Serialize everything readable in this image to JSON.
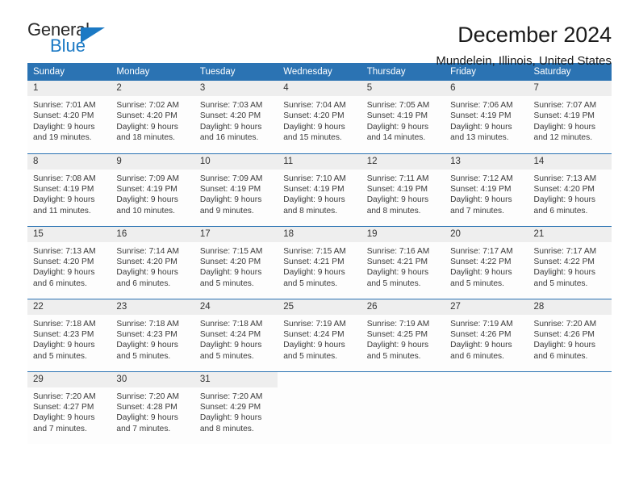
{
  "logo": {
    "name_part1": "General",
    "name_part2": "Blue",
    "flag_icon": "blue-triangle-flag-icon",
    "brand_color": "#1b79c4"
  },
  "header": {
    "title": "December 2024",
    "subtitle": "Mundelein, Illinois, United States"
  },
  "theme": {
    "header_blue": "#2b73b3",
    "daynum_gray": "#eeeeee",
    "text_dark": "#3a3a3a"
  },
  "labels": {
    "sunrise_prefix": "Sunrise:",
    "sunset_prefix": "Sunset:",
    "daylight_prefix": "Daylight:"
  },
  "weekday_headers": [
    "Sunday",
    "Monday",
    "Tuesday",
    "Wednesday",
    "Thursday",
    "Friday",
    "Saturday"
  ],
  "weeks": [
    [
      {
        "day": "1",
        "sunrise": "Sunrise: 7:01 AM",
        "sunset": "Sunset: 4:20 PM",
        "daylight_line1": "Daylight: 9 hours",
        "daylight_line2": "and 19 minutes."
      },
      {
        "day": "2",
        "sunrise": "Sunrise: 7:02 AM",
        "sunset": "Sunset: 4:20 PM",
        "daylight_line1": "Daylight: 9 hours",
        "daylight_line2": "and 18 minutes."
      },
      {
        "day": "3",
        "sunrise": "Sunrise: 7:03 AM",
        "sunset": "Sunset: 4:20 PM",
        "daylight_line1": "Daylight: 9 hours",
        "daylight_line2": "and 16 minutes."
      },
      {
        "day": "4",
        "sunrise": "Sunrise: 7:04 AM",
        "sunset": "Sunset: 4:20 PM",
        "daylight_line1": "Daylight: 9 hours",
        "daylight_line2": "and 15 minutes."
      },
      {
        "day": "5",
        "sunrise": "Sunrise: 7:05 AM",
        "sunset": "Sunset: 4:19 PM",
        "daylight_line1": "Daylight: 9 hours",
        "daylight_line2": "and 14 minutes."
      },
      {
        "day": "6",
        "sunrise": "Sunrise: 7:06 AM",
        "sunset": "Sunset: 4:19 PM",
        "daylight_line1": "Daylight: 9 hours",
        "daylight_line2": "and 13 minutes."
      },
      {
        "day": "7",
        "sunrise": "Sunrise: 7:07 AM",
        "sunset": "Sunset: 4:19 PM",
        "daylight_line1": "Daylight: 9 hours",
        "daylight_line2": "and 12 minutes."
      }
    ],
    [
      {
        "day": "8",
        "sunrise": "Sunrise: 7:08 AM",
        "sunset": "Sunset: 4:19 PM",
        "daylight_line1": "Daylight: 9 hours",
        "daylight_line2": "and 11 minutes."
      },
      {
        "day": "9",
        "sunrise": "Sunrise: 7:09 AM",
        "sunset": "Sunset: 4:19 PM",
        "daylight_line1": "Daylight: 9 hours",
        "daylight_line2": "and 10 minutes."
      },
      {
        "day": "10",
        "sunrise": "Sunrise: 7:09 AM",
        "sunset": "Sunset: 4:19 PM",
        "daylight_line1": "Daylight: 9 hours",
        "daylight_line2": "and 9 minutes."
      },
      {
        "day": "11",
        "sunrise": "Sunrise: 7:10 AM",
        "sunset": "Sunset: 4:19 PM",
        "daylight_line1": "Daylight: 9 hours",
        "daylight_line2": "and 8 minutes."
      },
      {
        "day": "12",
        "sunrise": "Sunrise: 7:11 AM",
        "sunset": "Sunset: 4:19 PM",
        "daylight_line1": "Daylight: 9 hours",
        "daylight_line2": "and 8 minutes."
      },
      {
        "day": "13",
        "sunrise": "Sunrise: 7:12 AM",
        "sunset": "Sunset: 4:19 PM",
        "daylight_line1": "Daylight: 9 hours",
        "daylight_line2": "and 7 minutes."
      },
      {
        "day": "14",
        "sunrise": "Sunrise: 7:13 AM",
        "sunset": "Sunset: 4:20 PM",
        "daylight_line1": "Daylight: 9 hours",
        "daylight_line2": "and 6 minutes."
      }
    ],
    [
      {
        "day": "15",
        "sunrise": "Sunrise: 7:13 AM",
        "sunset": "Sunset: 4:20 PM",
        "daylight_line1": "Daylight: 9 hours",
        "daylight_line2": "and 6 minutes."
      },
      {
        "day": "16",
        "sunrise": "Sunrise: 7:14 AM",
        "sunset": "Sunset: 4:20 PM",
        "daylight_line1": "Daylight: 9 hours",
        "daylight_line2": "and 6 minutes."
      },
      {
        "day": "17",
        "sunrise": "Sunrise: 7:15 AM",
        "sunset": "Sunset: 4:20 PM",
        "daylight_line1": "Daylight: 9 hours",
        "daylight_line2": "and 5 minutes."
      },
      {
        "day": "18",
        "sunrise": "Sunrise: 7:15 AM",
        "sunset": "Sunset: 4:21 PM",
        "daylight_line1": "Daylight: 9 hours",
        "daylight_line2": "and 5 minutes."
      },
      {
        "day": "19",
        "sunrise": "Sunrise: 7:16 AM",
        "sunset": "Sunset: 4:21 PM",
        "daylight_line1": "Daylight: 9 hours",
        "daylight_line2": "and 5 minutes."
      },
      {
        "day": "20",
        "sunrise": "Sunrise: 7:17 AM",
        "sunset": "Sunset: 4:22 PM",
        "daylight_line1": "Daylight: 9 hours",
        "daylight_line2": "and 5 minutes."
      },
      {
        "day": "21",
        "sunrise": "Sunrise: 7:17 AM",
        "sunset": "Sunset: 4:22 PM",
        "daylight_line1": "Daylight: 9 hours",
        "daylight_line2": "and 5 minutes."
      }
    ],
    [
      {
        "day": "22",
        "sunrise": "Sunrise: 7:18 AM",
        "sunset": "Sunset: 4:23 PM",
        "daylight_line1": "Daylight: 9 hours",
        "daylight_line2": "and 5 minutes."
      },
      {
        "day": "23",
        "sunrise": "Sunrise: 7:18 AM",
        "sunset": "Sunset: 4:23 PM",
        "daylight_line1": "Daylight: 9 hours",
        "daylight_line2": "and 5 minutes."
      },
      {
        "day": "24",
        "sunrise": "Sunrise: 7:18 AM",
        "sunset": "Sunset: 4:24 PM",
        "daylight_line1": "Daylight: 9 hours",
        "daylight_line2": "and 5 minutes."
      },
      {
        "day": "25",
        "sunrise": "Sunrise: 7:19 AM",
        "sunset": "Sunset: 4:24 PM",
        "daylight_line1": "Daylight: 9 hours",
        "daylight_line2": "and 5 minutes."
      },
      {
        "day": "26",
        "sunrise": "Sunrise: 7:19 AM",
        "sunset": "Sunset: 4:25 PM",
        "daylight_line1": "Daylight: 9 hours",
        "daylight_line2": "and 5 minutes."
      },
      {
        "day": "27",
        "sunrise": "Sunrise: 7:19 AM",
        "sunset": "Sunset: 4:26 PM",
        "daylight_line1": "Daylight: 9 hours",
        "daylight_line2": "and 6 minutes."
      },
      {
        "day": "28",
        "sunrise": "Sunrise: 7:20 AM",
        "sunset": "Sunset: 4:26 PM",
        "daylight_line1": "Daylight: 9 hours",
        "daylight_line2": "and 6 minutes."
      }
    ],
    [
      {
        "day": "29",
        "sunrise": "Sunrise: 7:20 AM",
        "sunset": "Sunset: 4:27 PM",
        "daylight_line1": "Daylight: 9 hours",
        "daylight_line2": "and 7 minutes."
      },
      {
        "day": "30",
        "sunrise": "Sunrise: 7:20 AM",
        "sunset": "Sunset: 4:28 PM",
        "daylight_line1": "Daylight: 9 hours",
        "daylight_line2": "and 7 minutes."
      },
      {
        "day": "31",
        "sunrise": "Sunrise: 7:20 AM",
        "sunset": "Sunset: 4:29 PM",
        "daylight_line1": "Daylight: 9 hours",
        "daylight_line2": "and 8 minutes."
      },
      {
        "day": "",
        "sunrise": "",
        "sunset": "",
        "daylight_line1": "",
        "daylight_line2": ""
      },
      {
        "day": "",
        "sunrise": "",
        "sunset": "",
        "daylight_line1": "",
        "daylight_line2": ""
      },
      {
        "day": "",
        "sunrise": "",
        "sunset": "",
        "daylight_line1": "",
        "daylight_line2": ""
      },
      {
        "day": "",
        "sunrise": "",
        "sunset": "",
        "daylight_line1": "",
        "daylight_line2": ""
      }
    ]
  ]
}
